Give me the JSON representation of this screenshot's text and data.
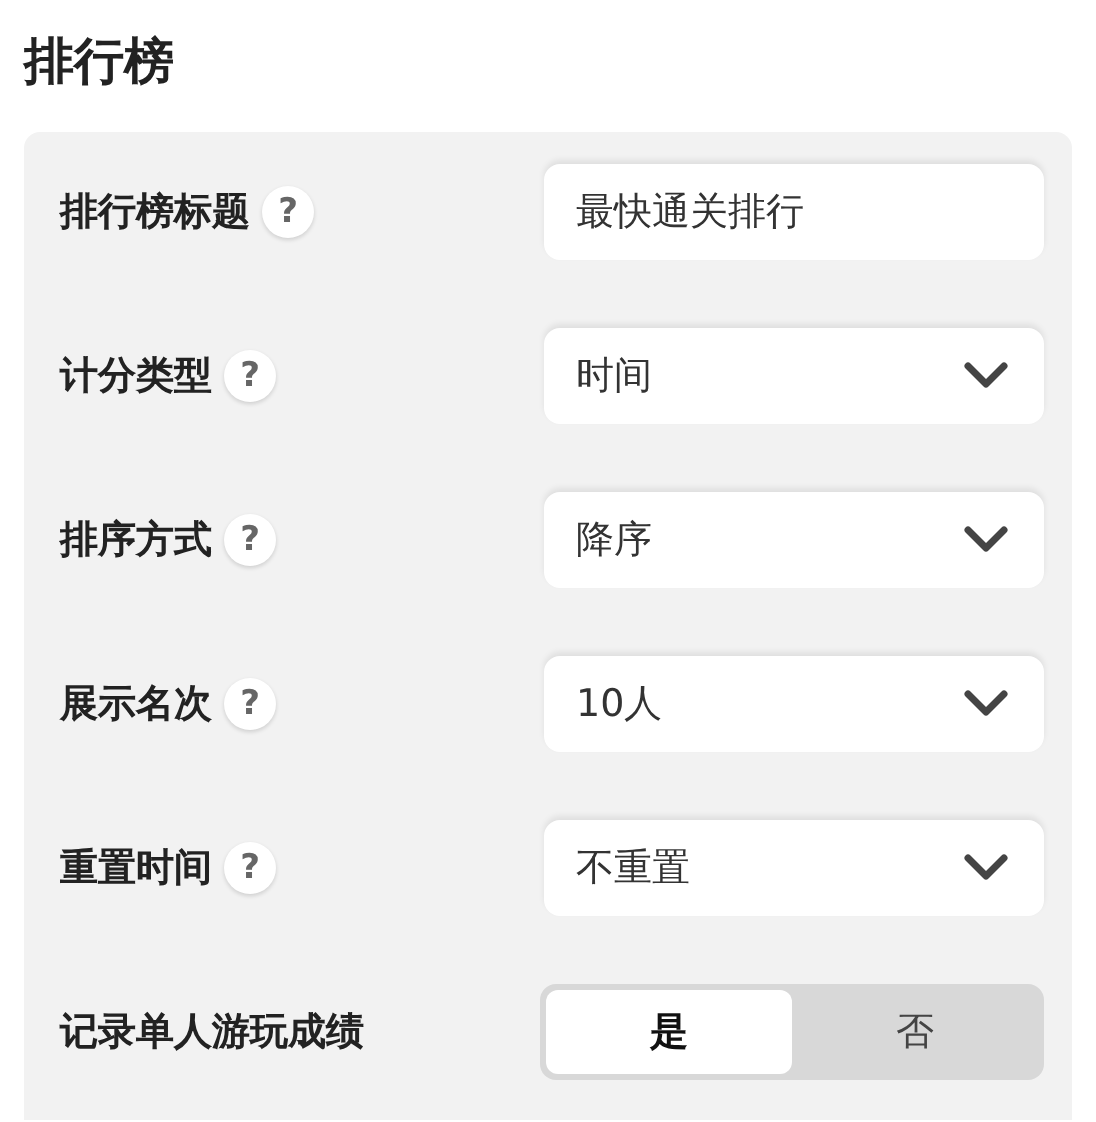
{
  "title": "排行榜",
  "fields": [
    {
      "kind": "text",
      "label": "排行榜标题",
      "help": "?",
      "value": "最快通关排行"
    },
    {
      "kind": "select",
      "label": "计分类型",
      "help": "?",
      "value": "时间"
    },
    {
      "kind": "select",
      "label": "排序方式",
      "help": "?",
      "value": "降序"
    },
    {
      "kind": "select",
      "label": "展示名次",
      "help": "?",
      "value": "10人"
    },
    {
      "kind": "select",
      "label": "重置时间",
      "help": "?",
      "value": "不重置"
    },
    {
      "kind": "toggle",
      "label": "记录单人游玩成绩",
      "options": [
        {
          "label": "是",
          "selected": true
        },
        {
          "label": "否",
          "selected": false
        }
      ]
    }
  ]
}
